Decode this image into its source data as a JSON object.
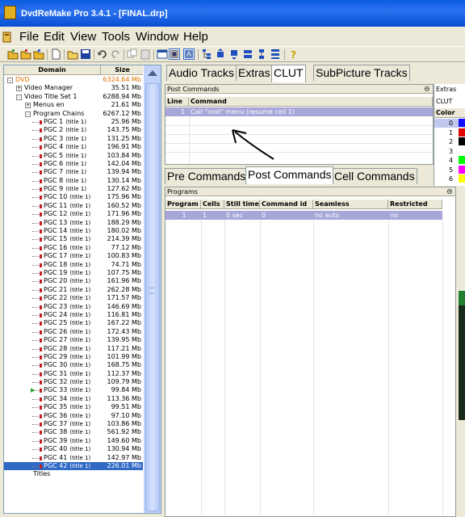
{
  "window": {
    "title": "DvdReMake Pro 3.4.1 - [FINAL.drp]"
  },
  "menu": [
    "File",
    "Edit",
    "View",
    "Tools",
    "Window",
    "Help"
  ],
  "tree": {
    "headers": {
      "domain": "Domain",
      "size": "Size"
    },
    "rows": [
      {
        "level": 0,
        "label": "DVD",
        "size": "6324.64 Mb",
        "style": "orange",
        "node": "-"
      },
      {
        "level": 1,
        "label": "Video Manager",
        "size": "35.51 Mb",
        "node": "+"
      },
      {
        "level": 1,
        "label": "Video Title Set 1",
        "size": "6288.94 Mb",
        "node": "-"
      },
      {
        "level": 2,
        "label": "Menus en",
        "size": "21.61 Mb",
        "node": "+"
      },
      {
        "level": 2,
        "label": "Program Chains",
        "size": "6267.12 Mb",
        "node": "-"
      },
      {
        "level": 3,
        "label": "PGC 1",
        "sub": "(title 1)",
        "size": "25.96 Mb"
      },
      {
        "level": 3,
        "label": "PGC 2",
        "sub": "(title 1)",
        "size": "143.75 Mb"
      },
      {
        "level": 3,
        "label": "PGC 3",
        "sub": "(title 1)",
        "size": "131.25 Mb"
      },
      {
        "level": 3,
        "label": "PGC 4",
        "sub": "(title 1)",
        "size": "196.91 Mb"
      },
      {
        "level": 3,
        "label": "PGC 5",
        "sub": "(title 1)",
        "size": "103.84 Mb"
      },
      {
        "level": 3,
        "label": "PGC 6",
        "sub": "(title 1)",
        "size": "142.04 Mb"
      },
      {
        "level": 3,
        "label": "PGC 7",
        "sub": "(title 1)",
        "size": "139.94 Mb"
      },
      {
        "level": 3,
        "label": "PGC 8",
        "sub": "(title 1)",
        "size": "130.14 Mb"
      },
      {
        "level": 3,
        "label": "PGC 9",
        "sub": "(title 1)",
        "size": "127.62 Mb"
      },
      {
        "level": 3,
        "label": "PGC 10",
        "sub": "(title 1)",
        "size": "175.96 Mb"
      },
      {
        "level": 3,
        "label": "PGC 11",
        "sub": "(title 1)",
        "size": "160.52 Mb"
      },
      {
        "level": 3,
        "label": "PGC 12",
        "sub": "(title 1)",
        "size": "171.96 Mb"
      },
      {
        "level": 3,
        "label": "PGC 13",
        "sub": "(title 1)",
        "size": "188.29 Mb"
      },
      {
        "level": 3,
        "label": "PGC 14",
        "sub": "(title 1)",
        "size": "180.02 Mb"
      },
      {
        "level": 3,
        "label": "PGC 15",
        "sub": "(title 1)",
        "size": "214.39 Mb"
      },
      {
        "level": 3,
        "label": "PGC 16",
        "sub": "(title 1)",
        "size": "77.12 Mb"
      },
      {
        "level": 3,
        "label": "PGC 17",
        "sub": "(title 1)",
        "size": "100.83 Mb"
      },
      {
        "level": 3,
        "label": "PGC 18",
        "sub": "(title 1)",
        "size": "74.71 Mb"
      },
      {
        "level": 3,
        "label": "PGC 19",
        "sub": "(title 1)",
        "size": "107.75 Mb"
      },
      {
        "level": 3,
        "label": "PGC 20",
        "sub": "(title 1)",
        "size": "161.96 Mb"
      },
      {
        "level": 3,
        "label": "PGC 21",
        "sub": "(title 1)",
        "size": "262.28 Mb"
      },
      {
        "level": 3,
        "label": "PGC 22",
        "sub": "(title 1)",
        "size": "171.57 Mb"
      },
      {
        "level": 3,
        "label": "PGC 23",
        "sub": "(title 1)",
        "size": "146.69 Mb"
      },
      {
        "level": 3,
        "label": "PGC 24",
        "sub": "(title 1)",
        "size": "116.81 Mb"
      },
      {
        "level": 3,
        "label": "PGC 25",
        "sub": "(title 1)",
        "size": "167.22 Mb"
      },
      {
        "level": 3,
        "label": "PGC 26",
        "sub": "(title 1)",
        "size": "172.43 Mb"
      },
      {
        "level": 3,
        "label": "PGC 27",
        "sub": "(title 1)",
        "size": "139.95 Mb"
      },
      {
        "level": 3,
        "label": "PGC 28",
        "sub": "(title 1)",
        "size": "117.21 Mb"
      },
      {
        "level": 3,
        "label": "PGC 29",
        "sub": "(title 1)",
        "size": "101.99 Mb"
      },
      {
        "level": 3,
        "label": "PGC 30",
        "sub": "(title 1)",
        "size": "168.75 Mb"
      },
      {
        "level": 3,
        "label": "PGC 31",
        "sub": "(title 1)",
        "size": "112.37 Mb"
      },
      {
        "level": 3,
        "label": "PGC 32",
        "sub": "(title 1)",
        "size": "109.79 Mb"
      },
      {
        "level": 3,
        "label": "PGC 33",
        "sub": "(title 1)",
        "size": "99.84 Mb",
        "arrow": true
      },
      {
        "level": 3,
        "label": "PGC 34",
        "sub": "(title 1)",
        "size": "113.36 Mb"
      },
      {
        "level": 3,
        "label": "PGC 35",
        "sub": "(title 1)",
        "size": "99.51 Mb"
      },
      {
        "level": 3,
        "label": "PGC 36",
        "sub": "(title 1)",
        "size": "97.10 Mb"
      },
      {
        "level": 3,
        "label": "PGC 37",
        "sub": "(title 1)",
        "size": "103.86 Mb"
      },
      {
        "level": 3,
        "label": "PGC 38",
        "sub": "(title 1)",
        "size": "561.92 Mb"
      },
      {
        "level": 3,
        "label": "PGC 39",
        "sub": "(title 1)",
        "size": "149.60 Mb"
      },
      {
        "level": 3,
        "label": "PGC 40",
        "sub": "(title 1)",
        "size": "130.94 Mb"
      },
      {
        "level": 3,
        "label": "PGC 41",
        "sub": "(title 1)",
        "size": "142.97 Mb"
      },
      {
        "level": 3,
        "label": "PGC 42",
        "sub": "(title 1)",
        "size": "226.01 Mb",
        "selected": true
      },
      {
        "level": 2,
        "label": "Titles",
        "size": "",
        "node": ""
      }
    ]
  },
  "top_tabs": [
    "Audio Tracks",
    "Extras",
    "CLUT",
    "SubPicture Tracks"
  ],
  "post_commands_panel": {
    "title": "Post Commands",
    "pin": "Θ",
    "headers": {
      "line": "Line",
      "command": "Command"
    },
    "rows": [
      {
        "line": "1",
        "command": "Call \"root\" menu (resume cell 1)"
      }
    ]
  },
  "command_tabs": [
    "Pre Commands",
    "Post Commands",
    "Cell Commands"
  ],
  "programs_panel": {
    "title": "Programs",
    "pin": "Θ",
    "headers": [
      "Program",
      "Cells",
      "Still time",
      "Command id",
      "Seamless",
      "Restricted"
    ],
    "rows": [
      [
        "1",
        "1",
        "0 sec",
        "0",
        "no auto",
        "no"
      ]
    ]
  },
  "extras_panel": {
    "title": "Extras",
    "clut_label": "CLUT",
    "color_header": "Color",
    "rows": [
      {
        "n": "0",
        "color": "#1010ff"
      },
      {
        "n": "1",
        "color": "#e00000"
      },
      {
        "n": "2",
        "color": "#000000"
      },
      {
        "n": "3",
        "color": "#ffffff"
      },
      {
        "n": "4",
        "color": "#00ff00"
      },
      {
        "n": "5",
        "color": "#ff00ff"
      },
      {
        "n": "6",
        "color": "#ffff00"
      }
    ]
  },
  "colors": {
    "titlebar": "#0a5be0",
    "selection": "#316ac5",
    "row_highlight": "#a6a6d8"
  }
}
